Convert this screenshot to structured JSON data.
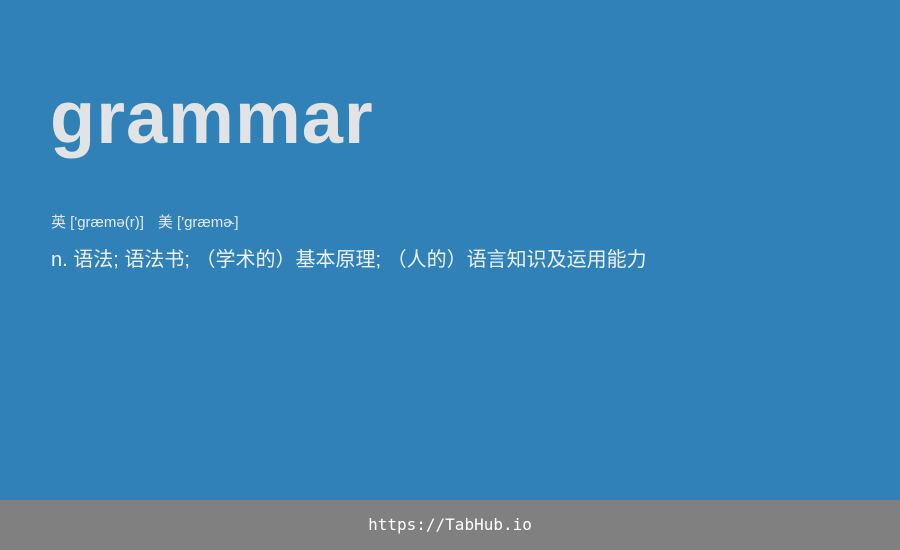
{
  "word": "grammar",
  "pronunciation": {
    "uk": "英 ['ɡræmə(r)]",
    "us": "美 ['ɡræmɚ]"
  },
  "definition": "n. 语法; 语法书; （学术的）基本原理; （人的）语言知识及运用能力",
  "footer": {
    "url": "https://TabHub.io"
  },
  "colors": {
    "background": "#2f81b8",
    "footer_background": "#808080",
    "word_text": "#e1e3e5"
  }
}
